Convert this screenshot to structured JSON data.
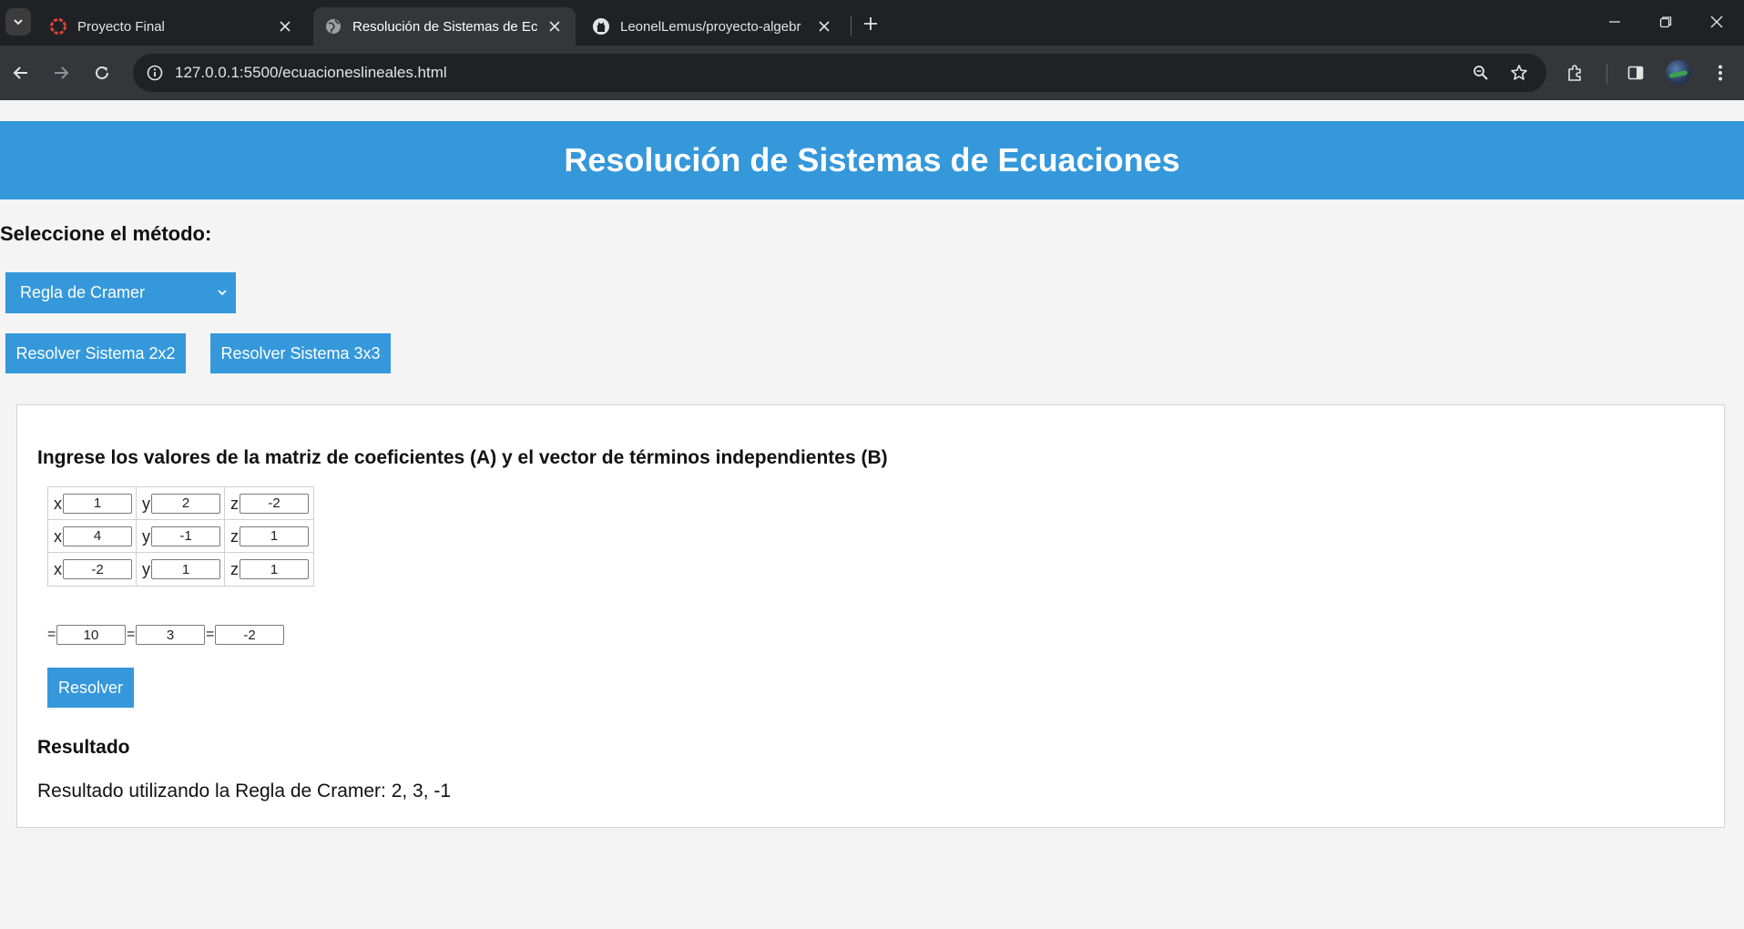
{
  "browser": {
    "tabs": [
      {
        "title": "Proyecto Final",
        "favicon": "red-circle-icon",
        "active": false
      },
      {
        "title": "Resolución de Sistemas de Ecu",
        "favicon": "globe-icon",
        "active": true
      },
      {
        "title": "LeonelLemus/proyecto-algebr",
        "favicon": "github-icon",
        "active": false
      }
    ],
    "url": "127.0.0.1:5500/ecuacioneslineales.html"
  },
  "page": {
    "title": "Resolución de Sistemas de Ecuaciones",
    "method_label": "Seleccione el método:",
    "method_selected": "Regla de Cramer",
    "button_2x2": "Resolver Sistema 2x2",
    "button_3x3": "Resolver Sistema 3x3",
    "panel": {
      "heading": "Ingrese los valores de la matriz de coeficientes (A) y el vector de términos independientes (B)",
      "matrix": [
        [
          {
            "var": "x",
            "value": "1"
          },
          {
            "var": "y",
            "value": "2"
          },
          {
            "var": "z",
            "value": "-2"
          }
        ],
        [
          {
            "var": "x",
            "value": "4"
          },
          {
            "var": "y",
            "value": "-1"
          },
          {
            "var": "z",
            "value": "1"
          }
        ],
        [
          {
            "var": "x",
            "value": "-2"
          },
          {
            "var": "y",
            "value": "1"
          },
          {
            "var": "z",
            "value": "1"
          }
        ]
      ],
      "vector": [
        {
          "sign": "=",
          "value": "10"
        },
        {
          "sign": "=",
          "value": "3"
        },
        {
          "sign": "=",
          "value": "-2"
        }
      ],
      "solve_button": "Resolver",
      "result_heading": "Resultado",
      "result_text": "Resultado utilizando la Regla de Cramer: 2, 3, -1"
    }
  },
  "colors": {
    "accent": "#3498db",
    "tabstrip": "#202124",
    "toolbar": "#35363a",
    "page_background": "#f4f4f4"
  }
}
